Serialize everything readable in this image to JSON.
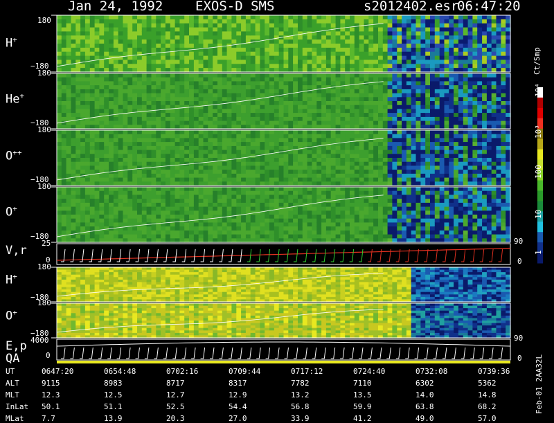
{
  "header": {
    "date": "Jan 24, 1992",
    "instrument": "EXOS-D SMS",
    "file": "s2012402.esr",
    "time": "06:47:20"
  },
  "panels": [
    {
      "label": "H+",
      "ymax": "180",
      "ymin": "−180",
      "colors": [
        "#5ab82c",
        "#8ccc2a",
        "#3aa02a",
        "#2e8e2a",
        "#aacc22"
      ]
    },
    {
      "label": "He+",
      "ymax": "180",
      "ymin": "−180",
      "colors": [
        "#2f8f2a",
        "#3d9f2e",
        "#4aa82e",
        "#26802a",
        "#5ab030"
      ]
    },
    {
      "label": "O++",
      "ymax": "180",
      "ymin": "−180",
      "colors": [
        "#2f8f2a",
        "#3d9f2e",
        "#4aa82e",
        "#26802a",
        "#5ab030"
      ]
    },
    {
      "label": "O+",
      "ymax": "180",
      "ymin": "−180",
      "colors": [
        "#2f8f2a",
        "#3d9f2e",
        "#4aa82e",
        "#26802a",
        "#5ab030"
      ]
    },
    {
      "label": "H+",
      "ymax": "180",
      "ymin": "−180",
      "colors": [
        "#c8d020",
        "#a8c020",
        "#e0e020",
        "#88b828",
        "#d8d830"
      ]
    },
    {
      "label": "O+",
      "ymax": "180",
      "ymin": "−180",
      "colors": [
        "#e8e820",
        "#c8c820",
        "#a0c028",
        "#70b830",
        "#d8d020"
      ]
    }
  ],
  "vr_panel": {
    "label": "V,r",
    "ymax": "25",
    "ymin": "0",
    "right_max": "90",
    "right_min": "0"
  },
  "ep_panel": {
    "label1": "E,p",
    "label2": "QA",
    "ymax": "4000",
    "ymin": "0",
    "right_max": "90",
    "right_min": "0"
  },
  "colorbar": {
    "unit": "Ct/Smp",
    "ticks": [
      "10⁴",
      "10³",
      "100",
      "10",
      "1"
    ],
    "colors": [
      "#ffffff",
      "#b00000",
      "#e00000",
      "#f03020",
      "#8a7a10",
      "#b8a818",
      "#e8e820",
      "#c8e030",
      "#88d028",
      "#4ab82a",
      "#2a9a2a",
      "#1a8a3a",
      "#20a0a0",
      "#20c0e0",
      "#1a5ab0",
      "#10308a",
      "#0a1a6a"
    ]
  },
  "footer": {
    "rows": [
      {
        "label": "UT",
        "values": [
          "0647:20",
          "0654:48",
          "0702:16",
          "0709:44",
          "0717:12",
          "0724:40",
          "0732:08",
          "0739:36"
        ]
      },
      {
        "label": "ALT",
        "values": [
          "9115",
          "8983",
          "8717",
          "8317",
          "7782",
          "7110",
          "6302",
          "5362"
        ]
      },
      {
        "label": "MLT",
        "values": [
          "12.3",
          "12.5",
          "12.7",
          "12.9",
          "13.2",
          "13.5",
          "14.0",
          "14.8"
        ]
      },
      {
        "label": "InLat",
        "values": [
          "50.1",
          "51.1",
          "52.5",
          "54.4",
          "56.8",
          "59.9",
          "63.8",
          "68.2"
        ]
      },
      {
        "label": "MLat",
        "values": [
          "7.7",
          "13.9",
          "20.3",
          "27.0",
          "33.9",
          "41.2",
          "49.0",
          "57.0"
        ]
      }
    ],
    "side_text": "Feb-01 2AA32L"
  }
}
